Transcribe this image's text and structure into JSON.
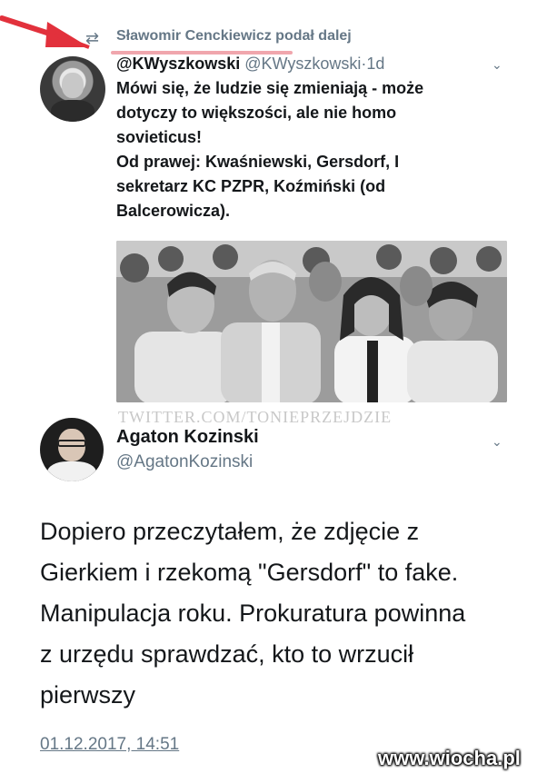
{
  "retweet": {
    "icon": "retweet-icon",
    "text": "Sławomir Cenckiewicz podał dalej"
  },
  "tweet1": {
    "avatar": "avatar",
    "display_name": "@KWyszkowski",
    "handle": "@KWyszkowski",
    "separator": "·",
    "age": "1d",
    "menu_icon": "chevron-down-icon",
    "lines": [
      "Mówi się, że ludzie się zmieniają - może",
      "dotyczy to większości, ale nie homo",
      "sovieticus!",
      "Od prawej: Kwaśniewski, Gersdorf, I",
      "sekretarz KC PZPR, Koźmiński (od",
      "Balcerowicza)."
    ],
    "photo_watermark": "TWITTER.COM/TONIEPRZEJDZIE"
  },
  "tweet2": {
    "display_name": "Agaton Kozinski",
    "handle": "@AgatonKozinski",
    "menu_icon": "chevron-down-icon",
    "body_lines": [
      "Dopiero przeczytałem, że zdjęcie z",
      "Gierkiem i rzekomą \"Gersdorf\" to fake.",
      "Manipulacja roku. Prokuratura powinna",
      "z urzędu sprawdzać, kto to wrzucił",
      "pierwszy"
    ],
    "timestamp": "01.12.2017, 14:51"
  },
  "site_watermark": "www.wiocha.pl",
  "colors": {
    "annotation_red": "#e2313c",
    "meta_gray": "#657786",
    "text": "#14171a"
  }
}
